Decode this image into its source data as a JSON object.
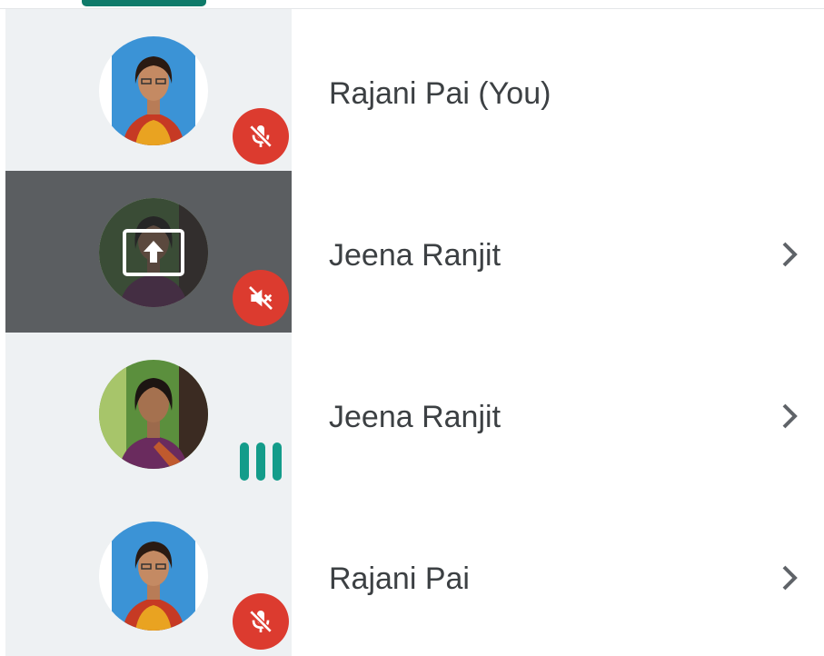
{
  "tabs": {
    "active_color": "#0f7b6a"
  },
  "colors": {
    "tile_bg": "#eef1f3",
    "presenting_bg": "#5b5e61",
    "muted_badge": "#dc3b2f",
    "speaking": "#139c8a",
    "name_text": "#3c4043"
  },
  "participants": [
    {
      "name": "Rajani Pai (You)",
      "avatar": "portrait-blue-background",
      "status": "mic-off",
      "status_icon": "mic-off-icon",
      "has_chevron": false
    },
    {
      "name": "Jeena Ranjit",
      "avatar": "portrait-outdoor",
      "status": "presenting",
      "status_icon": "volume-off-icon",
      "has_chevron": true
    },
    {
      "name": "Jeena Ranjit",
      "avatar": "portrait-outdoor",
      "status": "speaking",
      "status_icon": "speaking-bars-icon",
      "has_chevron": true
    },
    {
      "name": "Rajani Pai",
      "avatar": "portrait-blue-background",
      "status": "mic-off",
      "status_icon": "mic-off-icon",
      "has_chevron": true
    }
  ]
}
